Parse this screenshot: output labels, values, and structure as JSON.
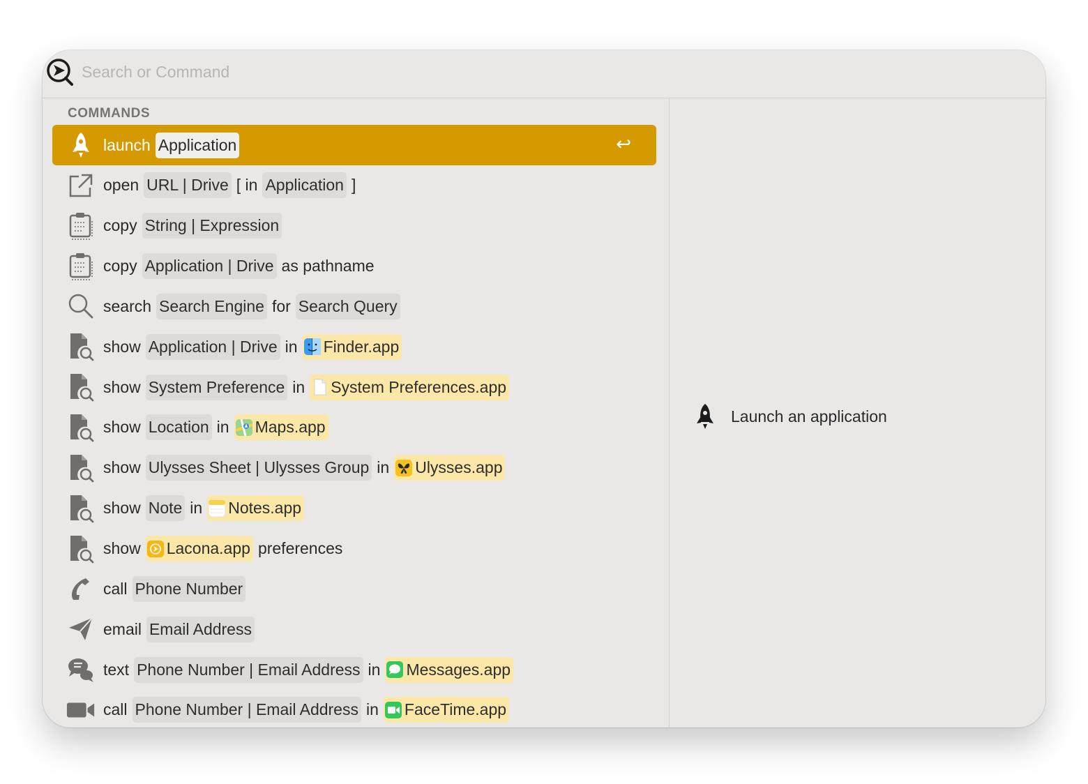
{
  "search": {
    "placeholder": "Search or Command",
    "value": ""
  },
  "section_header": "COMMANDS",
  "commands": [
    {
      "icon": "rocket-icon",
      "selected": true,
      "parts": [
        {
          "t": "kw",
          "text": "launch"
        },
        {
          "t": "ph",
          "text": "Application"
        }
      ]
    },
    {
      "icon": "external-link-icon",
      "parts": [
        {
          "t": "kw",
          "text": "open"
        },
        {
          "t": "ph",
          "text": "URL | Drive"
        },
        {
          "t": "kw",
          "text": "[ in"
        },
        {
          "t": "ph",
          "text": "Application"
        },
        {
          "t": "kw",
          "text": "]"
        }
      ]
    },
    {
      "icon": "clipboard-icon",
      "parts": [
        {
          "t": "kw",
          "text": "copy"
        },
        {
          "t": "ph",
          "text": "String | Expression"
        }
      ]
    },
    {
      "icon": "clipboard-icon",
      "parts": [
        {
          "t": "kw",
          "text": "copy"
        },
        {
          "t": "ph",
          "text": "Application | Drive"
        },
        {
          "t": "kw",
          "text": "as pathname"
        }
      ]
    },
    {
      "icon": "magnifier-icon",
      "parts": [
        {
          "t": "kw",
          "text": "search"
        },
        {
          "t": "ph",
          "text": "Search Engine"
        },
        {
          "t": "kw",
          "text": "for"
        },
        {
          "t": "ph",
          "text": "Search Query"
        }
      ]
    },
    {
      "icon": "document-search-icon",
      "parts": [
        {
          "t": "kw",
          "text": "show"
        },
        {
          "t": "ph",
          "text": "Application | Drive"
        },
        {
          "t": "kw",
          "text": "in"
        },
        {
          "t": "app",
          "text": "Finder.app",
          "app_icon": "finder-app-icon"
        }
      ]
    },
    {
      "icon": "document-search-icon",
      "parts": [
        {
          "t": "kw",
          "text": "show"
        },
        {
          "t": "ph",
          "text": "System Preference"
        },
        {
          "t": "kw",
          "text": "in"
        },
        {
          "t": "app",
          "text": "System Preferences.app",
          "app_icon": "blank-document-app-icon"
        }
      ]
    },
    {
      "icon": "document-search-icon",
      "parts": [
        {
          "t": "kw",
          "text": "show"
        },
        {
          "t": "ph",
          "text": "Location"
        },
        {
          "t": "kw",
          "text": "in"
        },
        {
          "t": "app",
          "text": "Maps.app",
          "app_icon": "maps-app-icon"
        }
      ]
    },
    {
      "icon": "document-search-icon",
      "parts": [
        {
          "t": "kw",
          "text": "show"
        },
        {
          "t": "ph",
          "text": "Ulysses Sheet | Ulysses Group"
        },
        {
          "t": "kw",
          "text": "in"
        },
        {
          "t": "app",
          "text": "Ulysses.app",
          "app_icon": "ulysses-app-icon"
        }
      ]
    },
    {
      "icon": "document-search-icon",
      "parts": [
        {
          "t": "kw",
          "text": "show"
        },
        {
          "t": "ph",
          "text": "Note"
        },
        {
          "t": "kw",
          "text": "in"
        },
        {
          "t": "app",
          "text": "Notes.app",
          "app_icon": "notes-app-icon"
        }
      ]
    },
    {
      "icon": "document-search-icon",
      "parts": [
        {
          "t": "kw",
          "text": "show"
        },
        {
          "t": "app",
          "text": "Lacona.app",
          "app_icon": "lacona-app-icon"
        },
        {
          "t": "kw",
          "text": "preferences"
        }
      ]
    },
    {
      "icon": "phone-icon",
      "parts": [
        {
          "t": "kw",
          "text": "call"
        },
        {
          "t": "ph",
          "text": "Phone Number"
        }
      ]
    },
    {
      "icon": "paper-plane-icon",
      "parts": [
        {
          "t": "kw",
          "text": "email"
        },
        {
          "t": "ph",
          "text": "Email Address"
        }
      ]
    },
    {
      "icon": "chat-bubbles-icon",
      "parts": [
        {
          "t": "kw",
          "text": "text"
        },
        {
          "t": "ph",
          "text": "Phone Number | Email Address"
        },
        {
          "t": "kw",
          "text": "in"
        },
        {
          "t": "app",
          "text": "Messages.app",
          "app_icon": "messages-app-icon"
        }
      ]
    },
    {
      "icon": "video-camera-icon",
      "parts": [
        {
          "t": "kw",
          "text": "call"
        },
        {
          "t": "ph",
          "text": "Phone Number | Email Address"
        },
        {
          "t": "kw",
          "text": "in"
        },
        {
          "t": "app",
          "text": "FaceTime.app",
          "app_icon": "facetime-app-icon"
        }
      ]
    }
  ],
  "selected_return_icon": "↩",
  "detail": {
    "icon": "rocket-icon",
    "text": "Launch an application"
  },
  "colors": {
    "selection": "#d49a00",
    "placeholder_chip": "#dcdbd9",
    "app_chip": "#fbe7a8",
    "window_bg": "#e9e8e7"
  }
}
